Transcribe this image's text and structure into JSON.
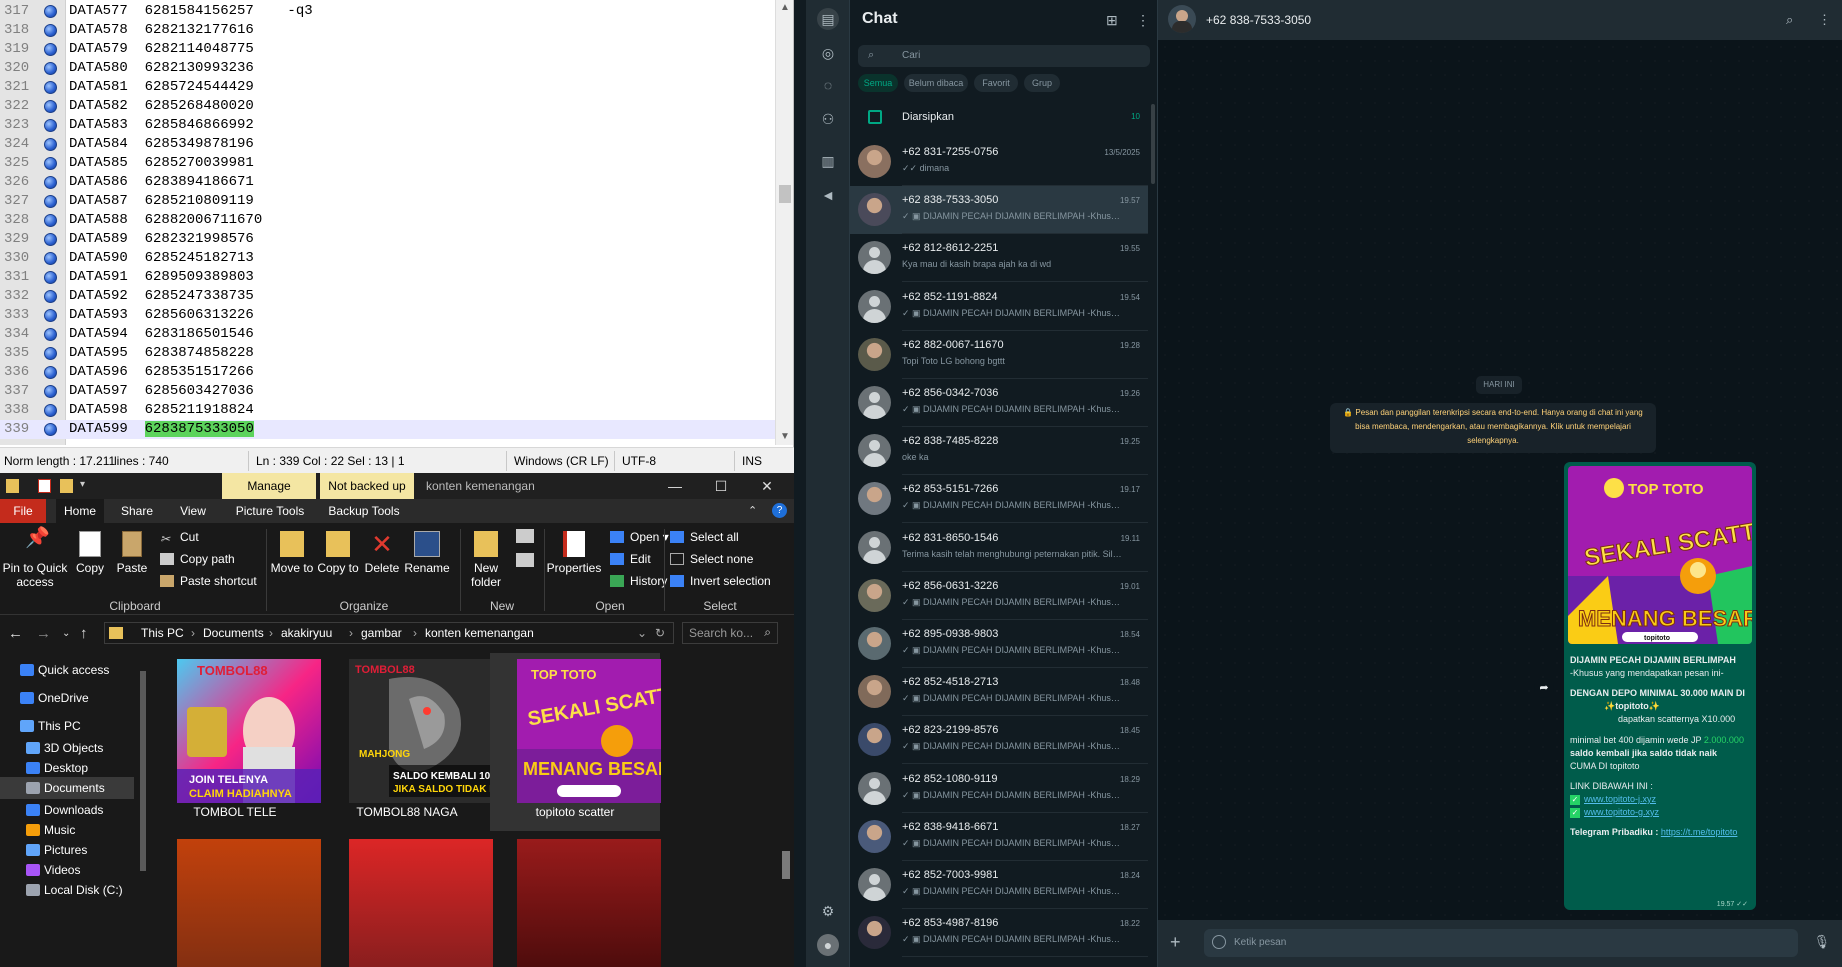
{
  "editor": {
    "rows": [
      {
        "line": "317",
        "text": "DATA577  6281584156257    -q3"
      },
      {
        "line": "318",
        "text": "DATA578  6282132177616"
      },
      {
        "line": "319",
        "text": "DATA579  6282114048775"
      },
      {
        "line": "320",
        "text": "DATA580  6282130993236"
      },
      {
        "line": "321",
        "text": "DATA581  6285724544429"
      },
      {
        "line": "322",
        "text": "DATA582  6285268480020"
      },
      {
        "line": "323",
        "text": "DATA583  6285846866992"
      },
      {
        "line": "324",
        "text": "DATA584  6285349878196"
      },
      {
        "line": "325",
        "text": "DATA585  6285270039981"
      },
      {
        "line": "326",
        "text": "DATA586  6283894186671"
      },
      {
        "line": "327",
        "text": "DATA587  6285210809119"
      },
      {
        "line": "328",
        "text": "DATA588  62882006711670"
      },
      {
        "line": "329",
        "text": "DATA589  6282321998576"
      },
      {
        "line": "330",
        "text": "DATA590  6285245182713"
      },
      {
        "line": "331",
        "text": "DATA591  6289509389803"
      },
      {
        "line": "332",
        "text": "DATA592  6285247338735"
      },
      {
        "line": "333",
        "text": "DATA593  6285606313226"
      },
      {
        "line": "334",
        "text": "DATA594  6283186501546"
      },
      {
        "line": "335",
        "text": "DATA595  6283874858228"
      },
      {
        "line": "336",
        "text": "DATA596  6285351517266"
      },
      {
        "line": "337",
        "text": "DATA597  6285603427036"
      },
      {
        "line": "338",
        "text": "DATA598  6285211918824"
      }
    ],
    "current_row": {
      "line": "339",
      "prefix": "DATA599  ",
      "selected": "6283875333050"
    },
    "status": {
      "length": "Norm length : 17.211",
      "lines": "lines : 740",
      "position": "Ln : 339    Col : 22    Sel : 13 | 1",
      "eol": "Windows (CR LF)",
      "encoding": "UTF-8",
      "mode": "INS"
    }
  },
  "explorer": {
    "context_tabs": {
      "manage": "Manage",
      "backup": "Not backed up",
      "title": "konten kemenangan"
    },
    "ribbon_tabs": [
      "File",
      "Home",
      "Share",
      "View",
      "Picture Tools",
      "Backup Tools"
    ],
    "ribbon": {
      "pin": "Pin to Quick access",
      "copy": "Copy",
      "paste": "Paste",
      "cut": "Cut",
      "copy_path": "Copy path",
      "paste_shortcut": "Paste shortcut",
      "move_to": "Move to",
      "copy_to": "Copy to",
      "delete": "Delete",
      "rename": "Rename",
      "new_folder": "New folder",
      "properties": "Properties",
      "open": "Open",
      "edit": "Edit",
      "history": "History",
      "select_all": "Select all",
      "select_none": "Select none",
      "invert_selection": "Invert selection",
      "groups": [
        "Clipboard",
        "Organize",
        "New",
        "Open",
        "Select"
      ]
    },
    "breadcrumb": [
      "This PC",
      "Documents",
      "akakiryuu",
      "gambar",
      "konten kemenangan"
    ],
    "search_placeholder": "Search ko...",
    "nav": [
      "Quick access",
      "OneDrive",
      "This PC",
      "3D Objects",
      "Desktop",
      "Documents",
      "Downloads",
      "Music",
      "Pictures",
      "Videos",
      "Local Disk (C:)"
    ],
    "nav_selected": "Documents",
    "files": [
      {
        "name": "TOMBOL TELE"
      },
      {
        "name": "TOMBOL88 NAGA"
      },
      {
        "name": "topitoto scatter"
      }
    ]
  },
  "whatsapp": {
    "title": "Chat",
    "search_placeholder": "Cari",
    "chips": [
      "Semua",
      "Belum dibaca",
      "Favorit",
      "Grup"
    ],
    "archived": {
      "label": "Diarsipkan",
      "count": "10"
    },
    "chats": [
      {
        "name": "+62 831-7255-0756",
        "time": "13/5/2025",
        "msg": "✓✓ dimana"
      },
      {
        "name": "+62 838-7533-3050",
        "time": "19.57",
        "msg": "✓ ▣ DIJAMIN PECAH DIJAMIN BERLIMPAH -Khusus y..."
      },
      {
        "name": "+62 812-8612-2251",
        "time": "19.55",
        "msg": "Kya mau di kasih brapa ajah ka di wd"
      },
      {
        "name": "+62 852-1191-8824",
        "time": "19.54",
        "msg": "✓ ▣ DIJAMIN PECAH DIJAMIN BERLIMPAH -Khusus y..."
      },
      {
        "name": "+62 882-0067-11670",
        "time": "19.28",
        "msg": "Topi Toto LG bohong bgttt"
      },
      {
        "name": "+62 856-0342-7036",
        "time": "19.26",
        "msg": "✓ ▣ DIJAMIN PECAH DIJAMIN BERLIMPAH -Khusus y..."
      },
      {
        "name": "+62 838-7485-8228",
        "time": "19.25",
        "msg": "oke ka"
      },
      {
        "name": "+62 853-5151-7266",
        "time": "19.17",
        "msg": "✓ ▣ DIJAMIN PECAH DIJAMIN BERLIMPAH -Khusus y..."
      },
      {
        "name": "+62 831-8650-1546",
        "time": "19.11",
        "msg": "Terima kasih telah menghubungi peternakan pitik. Silak..."
      },
      {
        "name": "+62 856-0631-3226",
        "time": "19.01",
        "msg": "✓ ▣ DIJAMIN PECAH DIJAMIN BERLIMPAH -Khusus y..."
      },
      {
        "name": "+62 895-0938-9803",
        "time": "18.54",
        "msg": "✓ ▣ DIJAMIN PECAH DIJAMIN BERLIMPAH -Khusus y..."
      },
      {
        "name": "+62 852-4518-2713",
        "time": "18.48",
        "msg": "✓ ▣ DIJAMIN PECAH DIJAMIN BERLIMPAH -Khusus y..."
      },
      {
        "name": "+62 823-2199-8576",
        "time": "18.45",
        "msg": "✓ ▣ DIJAMIN PECAH DIJAMIN BERLIMPAH -Khusus y..."
      },
      {
        "name": "+62 852-1080-9119",
        "time": "18.29",
        "msg": "✓ ▣ DIJAMIN PECAH DIJAMIN BERLIMPAH -Khusus y..."
      },
      {
        "name": "+62 838-9418-6671",
        "time": "18.27",
        "msg": "✓ ▣ DIJAMIN PECAH DIJAMIN BERLIMPAH -Khusus y..."
      },
      {
        "name": "+62 852-7003-9981",
        "time": "18.24",
        "msg": "✓ ▣ DIJAMIN PECAH DIJAMIN BERLIMPAH -Khusus y..."
      },
      {
        "name": "+62 853-4987-8196",
        "time": "18.22",
        "msg": "✓ ▣ DIJAMIN PECAH DIJAMIN BERLIMPAH -Khusus y..."
      }
    ],
    "conversation": {
      "contact": "+62 838-7533-3050",
      "day_chip": "HARI INI",
      "e2e_notice": "🔒 Pesan dan panggilan terenkripsi secara end-to-end. Hanya orang di chat ini yang bisa membaca, mendengarkan, atau membagikannya. Klik untuk mempelajari selengkapnya.",
      "message": {
        "line1": "DIJAMIN PECAH DIJAMIN BERLIMPAH",
        "line2": "-Khusus yang mendapatkan pesan ini-",
        "line3": "DENGAN DEPO MINIMAL 30.000 MAIN DI",
        "line4": "✨topitoto✨",
        "line5": "dapatkan scatternya X10.000",
        "line6a": "minimal bet 400 dijamin wede JP ",
        "line6b": "2.000.000",
        "line7": "saldo kembali jika saldo tidak naik",
        "line8": "CUMA DI topitoto",
        "line9": "LINK DIBAWAH INI :",
        "link1": "www.topitoto-j.xyz",
        "link2": "www.topitoto-g.xyz",
        "tg_label": "Telegram Pribadiku : ",
        "tg_link": "https://t.me/topitoto",
        "time": "19.57 ✓✓"
      },
      "composer_placeholder": "Ketik pesan"
    },
    "image": {
      "brand": "TOP TOTO",
      "line1": "SEKALI SCATTER",
      "line2": "MENANG BESAR",
      "tag": "topitoto"
    }
  }
}
